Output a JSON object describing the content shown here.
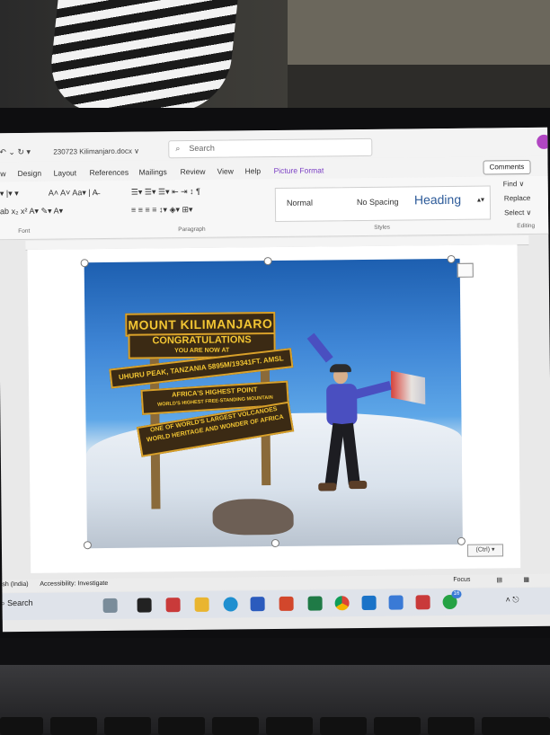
{
  "titlebar": {
    "filename": "230723 Kilimanjaro.docx ∨",
    "search_placeholder": "Search"
  },
  "tabs": [
    {
      "label": "ew"
    },
    {
      "label": "Design"
    },
    {
      "label": "Layout"
    },
    {
      "label": "References"
    },
    {
      "label": "Mailings"
    },
    {
      "label": "Review"
    },
    {
      "label": "View"
    },
    {
      "label": "Help"
    },
    {
      "label": "Picture Format"
    }
  ],
  "comments_label": "Comments",
  "ribbon": {
    "font_group": "Font",
    "paragraph_group": "Paragraph",
    "styles_group": "Styles",
    "editing_group": "Editing",
    "styles": [
      {
        "label": "Normal"
      },
      {
        "label": "No Spacing"
      },
      {
        "label": "Heading"
      }
    ],
    "editing": [
      {
        "label": "Find ∨"
      },
      {
        "label": "Replace"
      },
      {
        "label": "Select ∨"
      }
    ]
  },
  "photo_signs": {
    "line1": "MOUNT KILIMANJARO",
    "line2a": "CONGRATULATIONS",
    "line2b": "YOU ARE NOW AT",
    "line3": "UHURU PEAK, TANZANIA 5895M/19341FT. AMSL",
    "line4a": "AFRICA'S HIGHEST POINT",
    "line4b": "WORLD'S HIGHEST FREE-STANDING MOUNTAIN",
    "line5a": "ONE OF WORLD'S LARGEST VOLCANOES",
    "line5b": "WORLD HERITAGE AND WONDER OF AFRICA"
  },
  "ctrl_badge": "(Ctrl) ▾",
  "status": {
    "left": "sh (India)",
    "accessibility": "Accessibility: Investigate",
    "focus": "Focus"
  },
  "taskbar": {
    "search_label": "Search",
    "badge": "16"
  },
  "colors": {
    "accent": "#7b3fc4",
    "sign_text": "#f2c533",
    "sign_bg": "#3b2a14",
    "sky": "#3f86d6"
  }
}
